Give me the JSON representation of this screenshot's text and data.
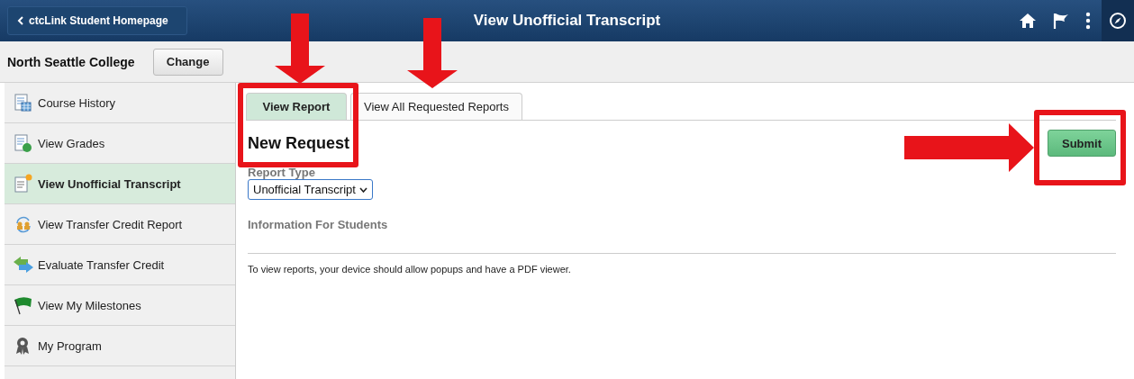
{
  "header": {
    "back_button": "ctcLink Student Homepage",
    "title": "View Unofficial Transcript"
  },
  "institution": {
    "name": "North Seattle College",
    "change_button": "Change"
  },
  "sidebar": {
    "items": [
      {
        "label": "Course History",
        "selected": false
      },
      {
        "label": "View Grades",
        "selected": false
      },
      {
        "label": "View Unofficial Transcript",
        "selected": true
      },
      {
        "label": "View Transfer Credit Report",
        "selected": false
      },
      {
        "label": "Evaluate Transfer Credit",
        "selected": false
      },
      {
        "label": "View My Milestones",
        "selected": false
      },
      {
        "label": "My Program",
        "selected": false
      }
    ]
  },
  "tabs": [
    {
      "label": "View Report",
      "selected": true
    },
    {
      "label": "View All Requested Reports",
      "selected": false
    }
  ],
  "form": {
    "heading": "New Request",
    "submit_button": "Submit",
    "report_type_label": "Report Type",
    "report_type_value": "Unofficial Transcript",
    "section_heading": "Information For Students",
    "note": "To view reports, your device should allow popups and have a PDF viewer."
  }
}
